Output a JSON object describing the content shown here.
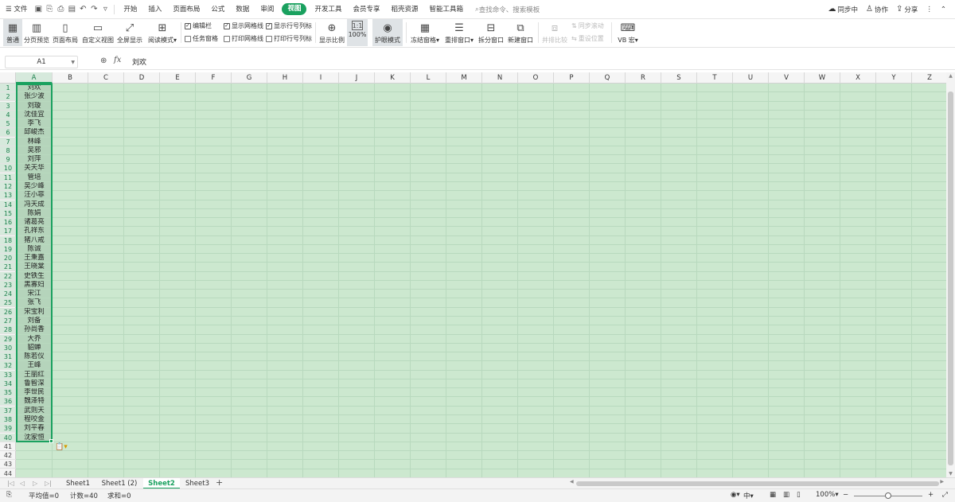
{
  "menubar": {
    "file": "文件",
    "tabs": [
      "开始",
      "插入",
      "页面布局",
      "公式",
      "数据",
      "审阅",
      "视图",
      "开发工具",
      "会员专享",
      "稻壳资源",
      "智能工具箱"
    ],
    "active_tab": "视图",
    "search_placeholder": "查找命令、搜索模板",
    "sync": "同步中",
    "collab": "协作",
    "share": "分享"
  },
  "ribbon": {
    "normal": "普通",
    "page_break": "分页预览",
    "page_layout": "页面布局",
    "custom_view": "自定义视图",
    "fullscreen": "全屏显示",
    "reading_mode": "阅读模式",
    "edit_bar": "编辑栏",
    "task_pane": "任务窗格",
    "show_gridlines": "显示网格线",
    "print_gridlines": "打印网格线",
    "show_headers": "显示行号列标",
    "print_headers": "打印行号列标",
    "zoom": "显示比例",
    "zoom100": "100%",
    "eye_mode": "护眼模式",
    "freeze": "冻结窗格",
    "arrange": "重排窗口",
    "split": "拆分窗口",
    "new_window": "新建窗口",
    "side_by_side": "并排比较",
    "sync_scroll": "同步滚动",
    "reset_pos": "重设位置",
    "vb_macro": "VB 宏"
  },
  "formula_bar": {
    "name_box": "A1",
    "fx": "fx",
    "content": "刘欢"
  },
  "grid": {
    "columns": [
      "A",
      "B",
      "C",
      "D",
      "E",
      "F",
      "G",
      "H",
      "I",
      "J",
      "K",
      "L",
      "M",
      "N",
      "O",
      "P",
      "Q",
      "R",
      "S",
      "T",
      "U",
      "V",
      "W",
      "X",
      "Y",
      "Z"
    ],
    "row_numbers": [
      "1",
      "2",
      "3",
      "4",
      "5",
      "6",
      "7",
      "8",
      "9",
      "10",
      "11",
      "12",
      "13",
      "14",
      "15",
      "16",
      "17",
      "18",
      "19",
      "20",
      "21",
      "22",
      "23",
      "24",
      "25",
      "26",
      "27",
      "28",
      "29",
      "30",
      "31",
      "32",
      "33",
      "34",
      "35",
      "36",
      "37",
      "38",
      "39",
      "40",
      "41",
      "42",
      "43",
      "44"
    ],
    "column_a": [
      "刘欢",
      "张少波",
      "刘璇",
      "沈佳宜",
      "李飞",
      "邱峻杰",
      "林峰",
      "吴邪",
      "刘萍",
      "关天华",
      "管培",
      "吴少峰",
      "汪小菲",
      "冯天成",
      "陈娟",
      "诸葛亮",
      "孔祥东",
      "猪八戒",
      "陈诚",
      "王秉嘉",
      "王晓棠",
      "史铁生",
      "黑寡妇",
      "宋江",
      "张飞",
      "宋宝利",
      "刘备",
      "孙尚香",
      "大乔",
      "貂蝉",
      "陈若仪",
      "王峰",
      "王丽红",
      "鲁智深",
      "李世民",
      "魏泽特",
      "武则天",
      "程咬金",
      "刘平春",
      "沈家恒"
    ]
  },
  "sheets": {
    "tabs": [
      "Sheet1",
      "Sheet1 (2)",
      "Sheet2",
      "Sheet3"
    ],
    "active": "Sheet2"
  },
  "status": {
    "average": "平均值=0",
    "count": "计数=40",
    "sum": "求和=0",
    "zoom": "100%"
  },
  "colors": {
    "accent": "#1aa15f",
    "eye_bg": "#cce8cf"
  }
}
